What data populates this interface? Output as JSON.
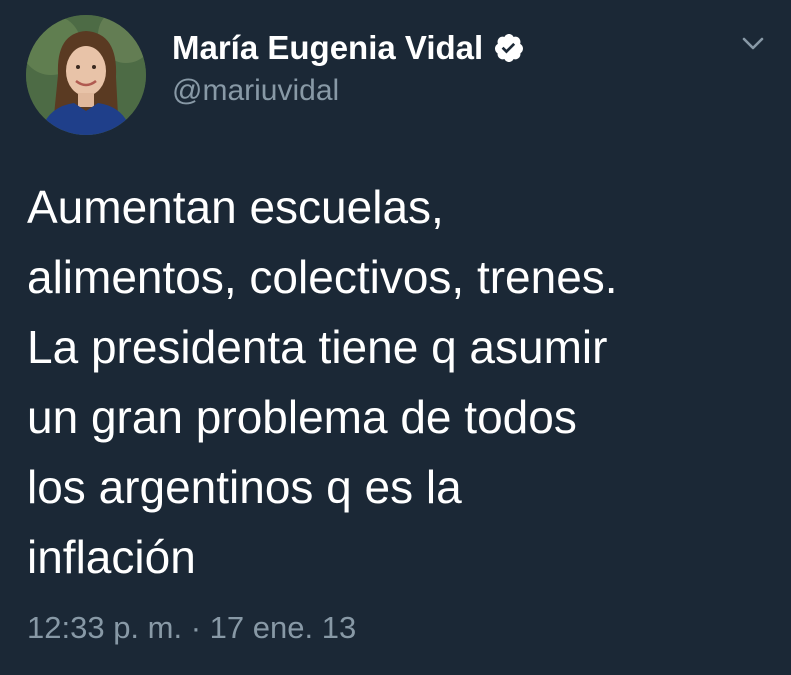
{
  "author": {
    "name": "María Eugenia Vidal",
    "handle": "@mariuvidal",
    "verified": true,
    "avatar_icon": "profile-photo"
  },
  "tweet": {
    "text": "Aumentan escuelas,\nalimentos, colectivos, trenes.\nLa presidenta tiene q asumir\nun gran problema de todos\nlos argentinos q es la\ninflación",
    "time": "12:33 p. m.",
    "separator": " · ",
    "date": "17 ene. 13"
  },
  "colors": {
    "background": "#1b2836",
    "primary_text": "#ffffff",
    "secondary_text": "#8899a6",
    "verified_badge": "#ffffff"
  },
  "icons": {
    "verified": "verified-badge-icon",
    "menu": "chevron-down-icon"
  }
}
